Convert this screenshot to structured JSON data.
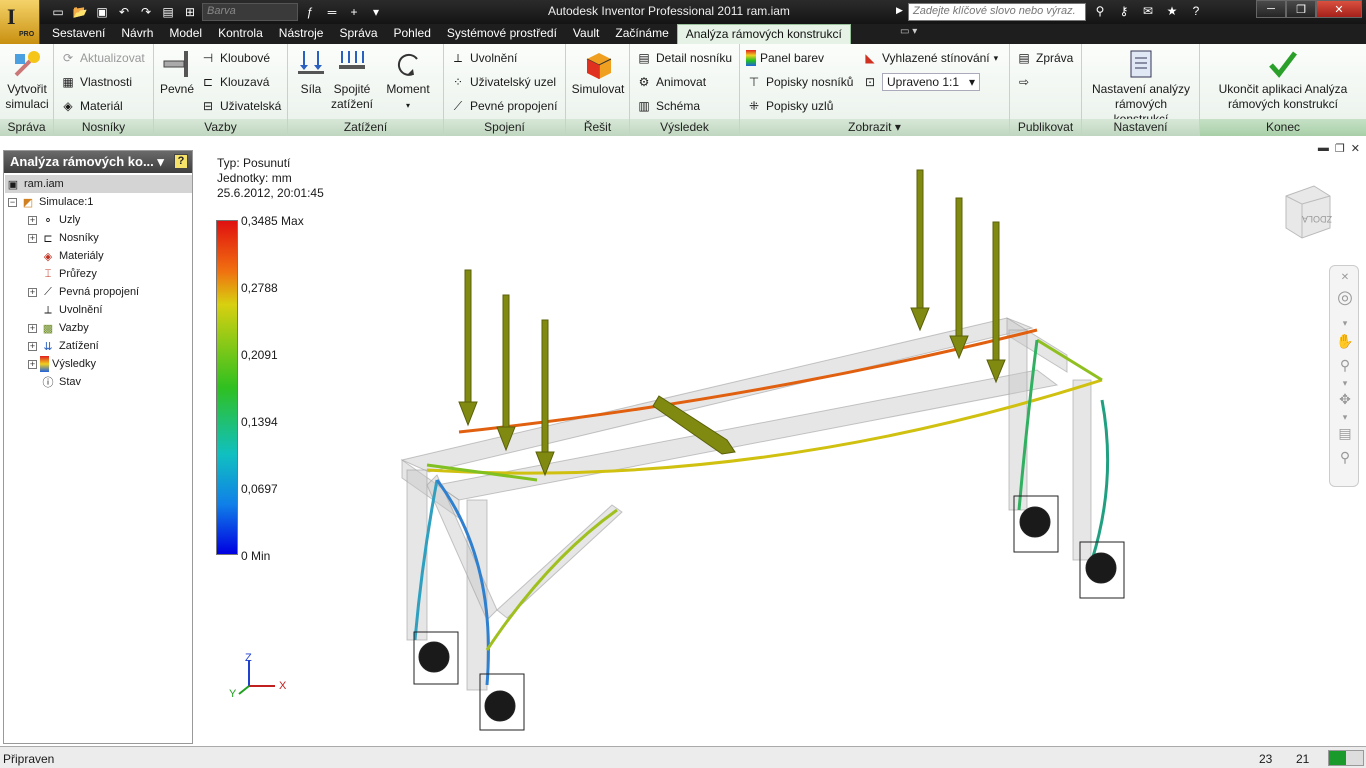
{
  "window": {
    "title": "Autodesk Inventor Professional 2011    ram.iam",
    "app_badge": "PRO"
  },
  "qat": {
    "color_select": "Barva",
    "search_placeholder": "Zadejte klíčové slovo nebo výraz."
  },
  "tabs": [
    {
      "label": "Sestavení"
    },
    {
      "label": "Návrh"
    },
    {
      "label": "Model"
    },
    {
      "label": "Kontrola"
    },
    {
      "label": "Nástroje"
    },
    {
      "label": "Správa"
    },
    {
      "label": "Pohled"
    },
    {
      "label": "Systémové prostředí"
    },
    {
      "label": "Vault"
    },
    {
      "label": "Začínáme"
    },
    {
      "label": "Analýza rámových konstrukcí",
      "active": true
    }
  ],
  "ribbon": {
    "sprava": {
      "title": "Správa",
      "create": "Vytvořit simulaci"
    },
    "nosniky": {
      "title": "Nosníky",
      "update": "Aktualizovat",
      "properties": "Vlastnosti",
      "material": "Materiál"
    },
    "vazby": {
      "title": "Vazby",
      "fixed": "Pevné",
      "pinned": "Kloubové",
      "floating": "Klouzavá",
      "custom": "Uživatelská"
    },
    "zatizeni": {
      "title": "Zatížení",
      "force": "Síla",
      "continuous": "Spojité zatížení",
      "moment": "Moment"
    },
    "spojeni": {
      "title": "Spojení",
      "release": "Uvolnění",
      "custom_node": "Uživatelský uzel",
      "rigid": "Pevné propojení"
    },
    "resit": {
      "title": "Řešit",
      "simulate": "Simulovat"
    },
    "vysledek": {
      "title": "Výsledek",
      "beam_detail": "Detail nosníku",
      "animate": "Animovat",
      "diagram": "Schéma"
    },
    "zobrazit": {
      "title": "Zobrazit",
      "color_bar": "Panel barev",
      "beam_labels": "Popisky nosníků",
      "node_labels": "Popisky uzlů",
      "shading": "Vyhlazené stínování",
      "scale": "Upraveno 1:1"
    },
    "publikovat": {
      "title": "Publikovat",
      "report": "Zpráva"
    },
    "nastaveni": {
      "title": "Nastavení",
      "settings": "Nastavení analýzy rámových konstrukcí"
    },
    "konec": {
      "title": "Konec",
      "finish": "Ukončit aplikaci Analýza rámových konstrukcí"
    }
  },
  "browser": {
    "title": "Analýza rámových ko...",
    "root": "ram.iam",
    "items": [
      {
        "label": "Simulace:1"
      },
      {
        "label": "Uzly"
      },
      {
        "label": "Nosníky"
      },
      {
        "label": "Materiály"
      },
      {
        "label": "Průřezy"
      },
      {
        "label": "Pevná propojení"
      },
      {
        "label": "Uvolnění"
      },
      {
        "label": "Vazby"
      },
      {
        "label": "Zatížení"
      },
      {
        "label": "Výsledky"
      },
      {
        "label": "Stav"
      }
    ]
  },
  "viewport": {
    "type": "Typ: Posunutí",
    "units": "Jednotky: mm",
    "timestamp": "25.6.2012, 20:01:45",
    "legend": [
      "0,3485 Max",
      "0,2788",
      "0,2091",
      "0,1394",
      "0,0697",
      "0 Min"
    ],
    "viewcube_face": "ZDOLA",
    "axes": {
      "x": "X",
      "y": "Y",
      "z": "Z"
    }
  },
  "status": {
    "text": "Připraven",
    "a": "23",
    "b": "21",
    "progress": 0.5
  }
}
